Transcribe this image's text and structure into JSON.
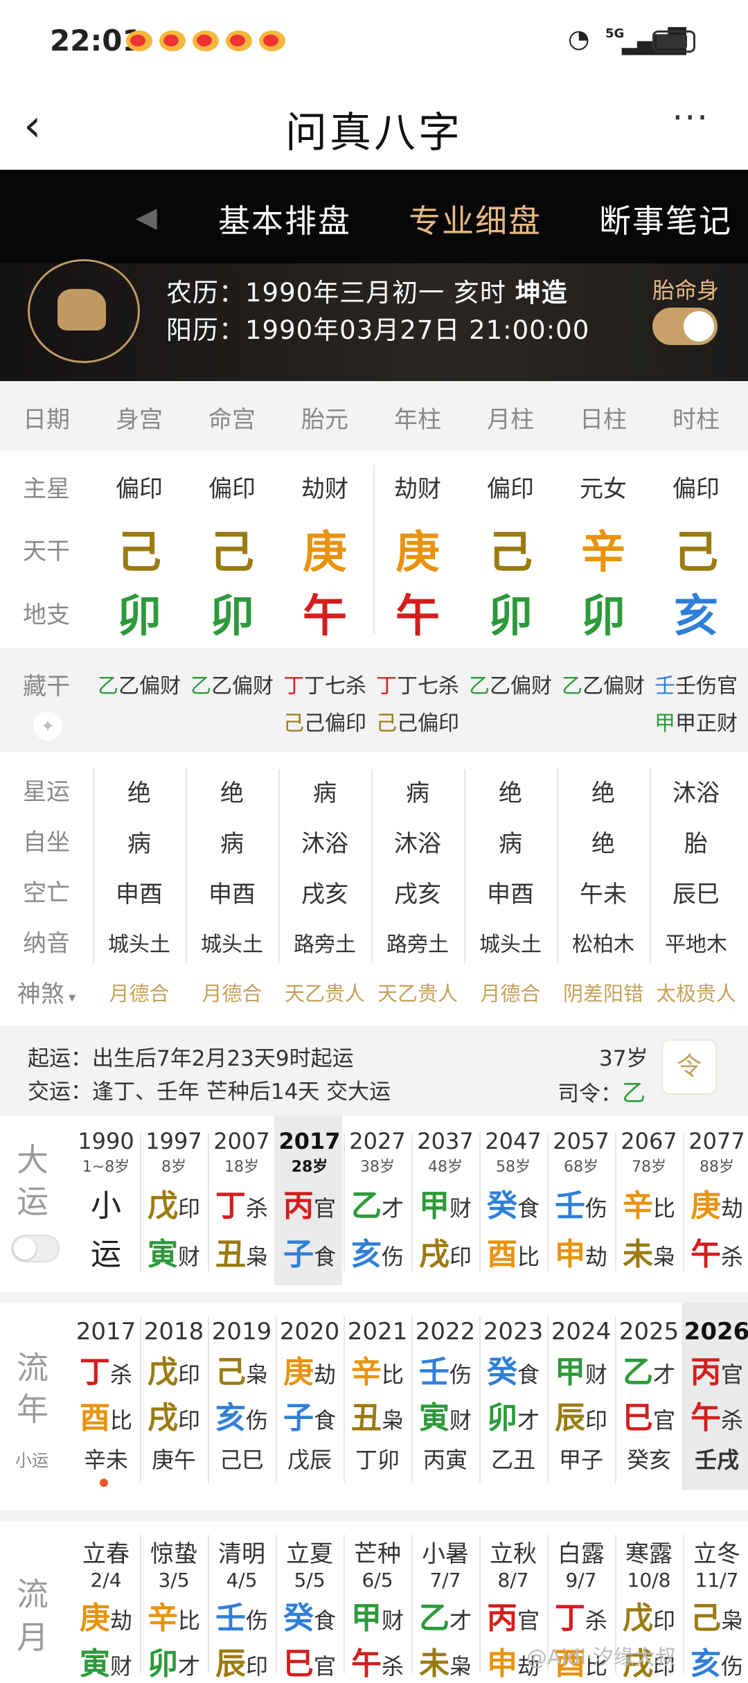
{
  "status": {
    "time": "22:01",
    "network": "5G"
  },
  "appbar": {
    "title": "问真八字",
    "more": "···"
  },
  "tabs": [
    {
      "label": "基本排盘"
    },
    {
      "label": "专业细盘"
    },
    {
      "label": "断事笔记"
    }
  ],
  "header": {
    "lunar_prefix": "农历：1990年三月初一 亥时 ",
    "lunar_gender": "坤造",
    "solar": "阳历：1990年03月27日 21:00:00",
    "toggle_label": "胎命身",
    "toggle_on": true
  },
  "cols": [
    "日期",
    "身宫",
    "命宫",
    "胎元",
    "年柱",
    "月柱",
    "日柱",
    "时柱"
  ],
  "rows": {
    "zhuxing": {
      "label": "主星",
      "values": [
        "偏印",
        "偏印",
        "劫财",
        "劫财",
        "偏印",
        "元女",
        "偏印"
      ]
    },
    "tiangan": {
      "label": "天干",
      "values": [
        "己",
        "己",
        "庚",
        "庚",
        "己",
        "辛",
        "己"
      ]
    },
    "dizhi": {
      "label": "地支",
      "values": [
        "卯",
        "卯",
        "午",
        "午",
        "卯",
        "卯",
        "亥"
      ]
    },
    "canggan": {
      "label": "藏干",
      "values": [
        [
          "乙偏财"
        ],
        [
          "乙偏财"
        ],
        [
          "丁七杀",
          "己偏印"
        ],
        [
          "丁七杀",
          "己偏印"
        ],
        [
          "乙偏财"
        ],
        [
          "乙偏财"
        ],
        [
          "壬伤官",
          "甲正财"
        ]
      ]
    },
    "xingyun": {
      "label": "星运",
      "values": [
        "绝",
        "绝",
        "病",
        "病",
        "绝",
        "绝",
        "沐浴"
      ]
    },
    "zizuo": {
      "label": "自坐",
      "values": [
        "病",
        "病",
        "沐浴",
        "沐浴",
        "病",
        "绝",
        "胎"
      ]
    },
    "kongwang": {
      "label": "空亡",
      "values": [
        "申酉",
        "申酉",
        "戌亥",
        "戌亥",
        "申酉",
        "午未",
        "辰巳"
      ]
    },
    "nayin": {
      "label": "纳音",
      "values": [
        "城头土",
        "城头土",
        "路旁土",
        "路旁土",
        "城头土",
        "松柏木",
        "平地木"
      ]
    },
    "shensha": {
      "label": "神煞",
      "values": [
        "月德合",
        "月德合",
        "天乙贵人",
        "天乙贵人",
        "月德合",
        "阴差阳错",
        "太极贵人"
      ]
    }
  },
  "qiyun": {
    "line1_label": "起运：",
    "line1": "出生后7年2月23天9时起运",
    "line2_label": "交运：",
    "line2": "逢丁、壬年 芒种后14天 交大运",
    "age": "37岁",
    "siling_label": "司令：",
    "siling": "乙",
    "icon": "令"
  },
  "dayun": {
    "label_top": "大",
    "label_bot": "运",
    "items": [
      {
        "year": "1990",
        "age": "1~8岁",
        "g": "小",
        "gt": "",
        "z": "运",
        "zt": ""
      },
      {
        "year": "1997",
        "age": "8岁",
        "g": "戊",
        "gt": "印",
        "z": "寅",
        "zt": "财"
      },
      {
        "year": "2007",
        "age": "18岁",
        "g": "丁",
        "gt": "杀",
        "z": "丑",
        "zt": "枭"
      },
      {
        "year": "2017",
        "age": "28岁",
        "g": "丙",
        "gt": "官",
        "z": "子",
        "zt": "食"
      },
      {
        "year": "2027",
        "age": "38岁",
        "g": "乙",
        "gt": "才",
        "z": "亥",
        "zt": "伤"
      },
      {
        "year": "2037",
        "age": "48岁",
        "g": "甲",
        "gt": "财",
        "z": "戌",
        "zt": "印"
      },
      {
        "year": "2047",
        "age": "58岁",
        "g": "癸",
        "gt": "食",
        "z": "酉",
        "zt": "比"
      },
      {
        "year": "2057",
        "age": "68岁",
        "g": "壬",
        "gt": "伤",
        "z": "申",
        "zt": "劫"
      },
      {
        "year": "2067",
        "age": "78岁",
        "g": "辛",
        "gt": "比",
        "z": "未",
        "zt": "枭"
      },
      {
        "year": "2077",
        "age": "88岁",
        "g": "庚",
        "gt": "劫",
        "z": "午",
        "zt": "杀"
      }
    ]
  },
  "liunian": {
    "label_top": "流",
    "label_bot": "年",
    "sub": "小运",
    "items": [
      {
        "year": "2017",
        "g": "丁",
        "gt": "杀",
        "z": "酉",
        "zt": "比",
        "xy": "辛未"
      },
      {
        "year": "2018",
        "g": "戊",
        "gt": "印",
        "z": "戌",
        "zt": "印",
        "xy": "庚午"
      },
      {
        "year": "2019",
        "g": "己",
        "gt": "枭",
        "z": "亥",
        "zt": "伤",
        "xy": "己巳"
      },
      {
        "year": "2020",
        "g": "庚",
        "gt": "劫",
        "z": "子",
        "zt": "食",
        "xy": "戊辰"
      },
      {
        "year": "2021",
        "g": "辛",
        "gt": "比",
        "z": "丑",
        "zt": "枭",
        "xy": "丁卯"
      },
      {
        "year": "2022",
        "g": "壬",
        "gt": "伤",
        "z": "寅",
        "zt": "财",
        "xy": "丙寅"
      },
      {
        "year": "2023",
        "g": "癸",
        "gt": "食",
        "z": "卯",
        "zt": "才",
        "xy": "乙丑"
      },
      {
        "year": "2024",
        "g": "甲",
        "gt": "财",
        "z": "辰",
        "zt": "印",
        "xy": "甲子"
      },
      {
        "year": "2025",
        "g": "乙",
        "gt": "才",
        "z": "巳",
        "zt": "官",
        "xy": "癸亥"
      },
      {
        "year": "2026",
        "g": "丙",
        "gt": "官",
        "z": "午",
        "zt": "杀",
        "xy": "壬戌"
      }
    ]
  },
  "liuyue": {
    "label_top": "流",
    "label_bot": "月",
    "items": [
      {
        "term": "立春",
        "date": "2/4",
        "g": "庚",
        "gt": "劫",
        "z": "寅",
        "zt": "财"
      },
      {
        "term": "惊蛰",
        "date": "3/5",
        "g": "辛",
        "gt": "比",
        "z": "卯",
        "zt": "才"
      },
      {
        "term": "清明",
        "date": "4/5",
        "g": "壬",
        "gt": "伤",
        "z": "辰",
        "zt": "印"
      },
      {
        "term": "立夏",
        "date": "5/5",
        "g": "癸",
        "gt": "食",
        "z": "巳",
        "zt": "官"
      },
      {
        "term": "芒种",
        "date": "6/5",
        "g": "甲",
        "gt": "财",
        "z": "午",
        "zt": "杀"
      },
      {
        "term": "小暑",
        "date": "7/7",
        "g": "乙",
        "gt": "才",
        "z": "未",
        "zt": "枭"
      },
      {
        "term": "立秋",
        "date": "8/7",
        "g": "丙",
        "gt": "官",
        "z": "申",
        "zt": "劫"
      },
      {
        "term": "白露",
        "date": "9/7",
        "g": "丁",
        "gt": "杀",
        "z": "酉",
        "zt": "比"
      },
      {
        "term": "寒露",
        "date": "10/8",
        "g": "戊",
        "gt": "印",
        "z": "戌",
        "zt": "印"
      },
      {
        "term": "立冬",
        "date": "11/7",
        "g": "己",
        "gt": "枭",
        "z": "亥",
        "zt": "伤"
      }
    ]
  },
  "watermark": "@Aidi·汐缘大叔",
  "colors": {
    "earth": "#9a7b12",
    "metal": "#e8930e",
    "wood": "#2c9a3a",
    "fire": "#d41d1d",
    "water": "#2f7fd8",
    "gold": "#c6a05a"
  }
}
